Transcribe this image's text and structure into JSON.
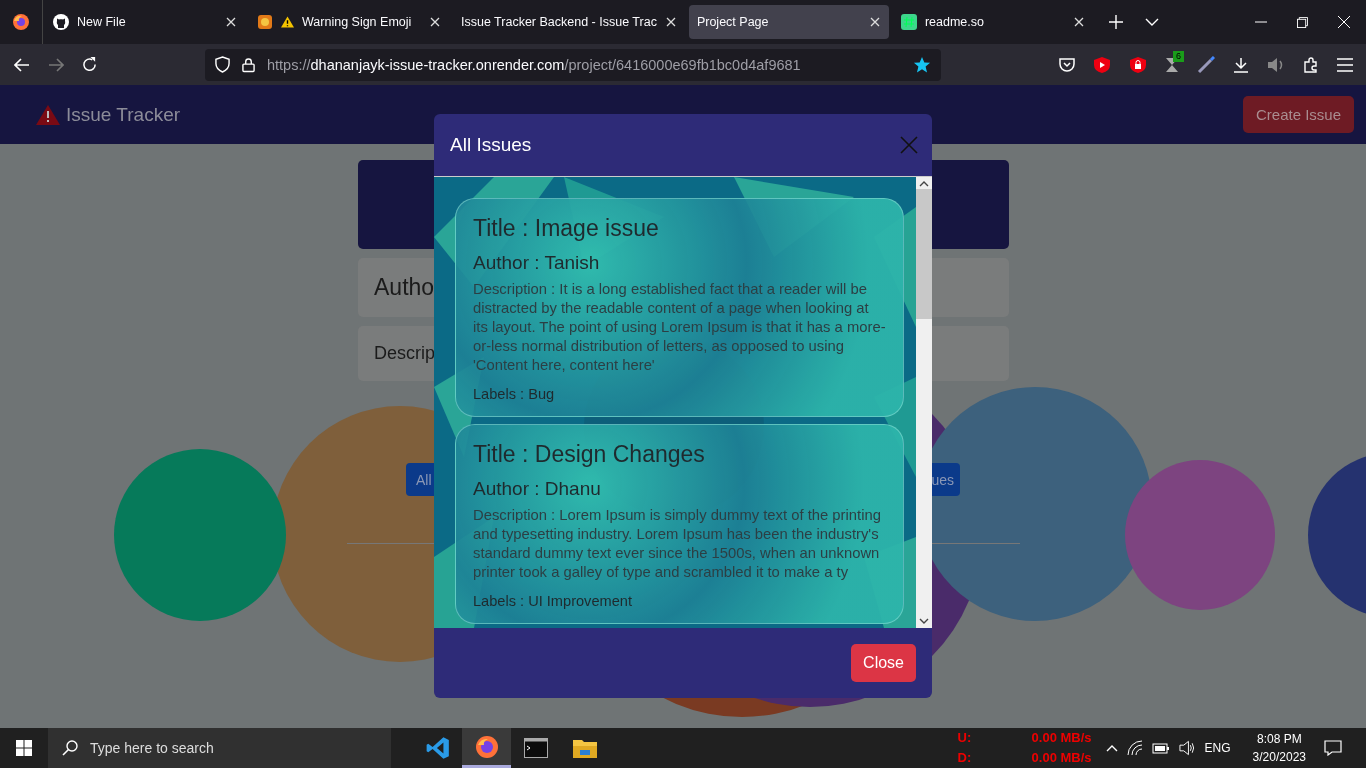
{
  "browser": {
    "tabs": [
      {
        "title": "New File",
        "kind": "github",
        "selected": false
      },
      {
        "title": "Warning Sign Emoji",
        "kind": "warning",
        "selected": false
      },
      {
        "title": "Issue Tracker Backend - Issue Trac",
        "kind": "none",
        "selected": false
      },
      {
        "title": "Project Page",
        "kind": "none",
        "selected": true
      },
      {
        "title": "readme.so",
        "kind": "readme",
        "selected": false
      }
    ],
    "url": {
      "scheme": "https://",
      "host": "dhananjayk-issue-tracker.onrender.com",
      "path": "/project/6416000e69fb1bc0d4af9681"
    },
    "extension_badge": "6"
  },
  "page": {
    "brand": "Issue Tracker",
    "create_button": "Create Issue",
    "author_field": "Autho",
    "description_field": "Descrip",
    "left_button": "All",
    "right_button": "ues"
  },
  "modal": {
    "title": "All Issues",
    "issues": [
      {
        "title": "Title : Image issue",
        "author": "Author : Tanish",
        "description": "Description : It is a long established fact that a reader will be distracted by the readable content of a page when looking at its layout. The point of using Lorem Ipsum is that it has a more-or-less normal distribution of letters, as opposed to using 'Content here, content here'",
        "labels": "Labels : Bug"
      },
      {
        "title": "Title : Design Changes",
        "author": "Author : Dhanu",
        "description": "Description : Lorem Ipsum is simply dummy text of the printing and typesetting industry. Lorem Ipsum has been the industry's standard dummy text ever since the 1500s, when an unknown printer took a galley of type and scrambled it to make a ty",
        "labels": "Labels : UI Improvement"
      }
    ],
    "close_button": "Close"
  },
  "taskbar": {
    "search_placeholder": "Type here to search",
    "apps": [
      {
        "kind": "vscode",
        "selected": false
      },
      {
        "kind": "firefox",
        "selected": true
      },
      {
        "kind": "terminal",
        "selected": false
      },
      {
        "kind": "folder",
        "selected": false
      }
    ],
    "upload_label": "U:",
    "upload_rate": "0.00 MB/s",
    "download_label": "D:",
    "download_rate": "0.00 MB/s",
    "language": "ENG",
    "time": "8:08 PM",
    "date": "3/20/2023"
  }
}
